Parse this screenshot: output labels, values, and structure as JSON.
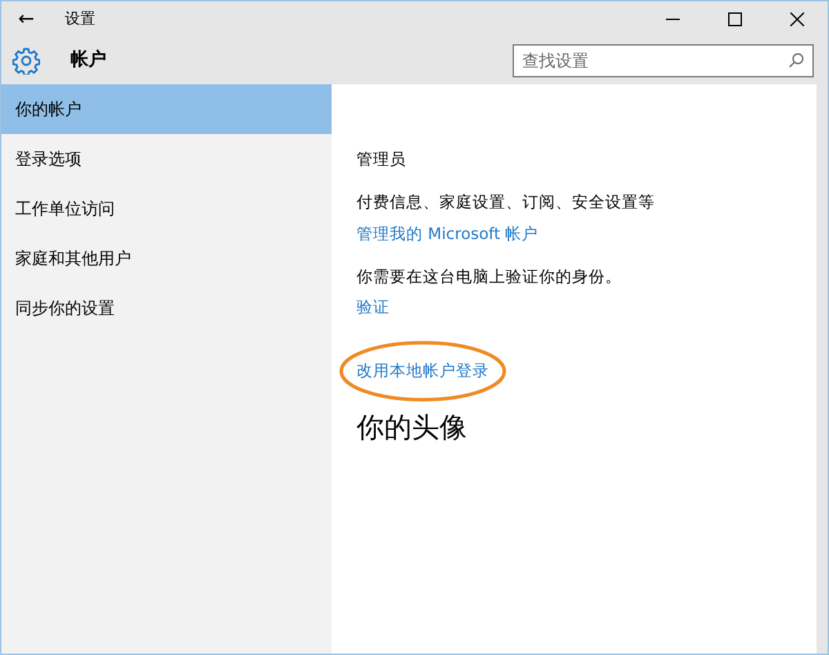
{
  "window": {
    "title": "设置",
    "back": "←"
  },
  "header": {
    "title": "帐户",
    "search": {
      "placeholder": "查找设置"
    }
  },
  "sidebar": {
    "items": [
      {
        "label": "你的帐户",
        "selected": true
      },
      {
        "label": "登录选项",
        "selected": false
      },
      {
        "label": "工作单位访问",
        "selected": false
      },
      {
        "label": "家庭和其他用户",
        "selected": false
      },
      {
        "label": "同步你的设置",
        "selected": false
      }
    ]
  },
  "content": [
    {
      "kind": "text",
      "text": "管理员"
    },
    {
      "kind": "text",
      "text": "付费信息、家庭设置、订阅、安全设置等"
    },
    {
      "kind": "link",
      "text": "管理我的 Microsoft 帐户",
      "highlighted": false
    },
    {
      "kind": "text",
      "text": "你需要在这台电脑上验证你的身份。"
    },
    {
      "kind": "link",
      "text": "验证",
      "highlighted": false
    },
    {
      "kind": "link",
      "text": "改用本地帐户登录",
      "highlighted": true
    },
    {
      "kind": "heading",
      "text": "你的头像"
    }
  ]
}
